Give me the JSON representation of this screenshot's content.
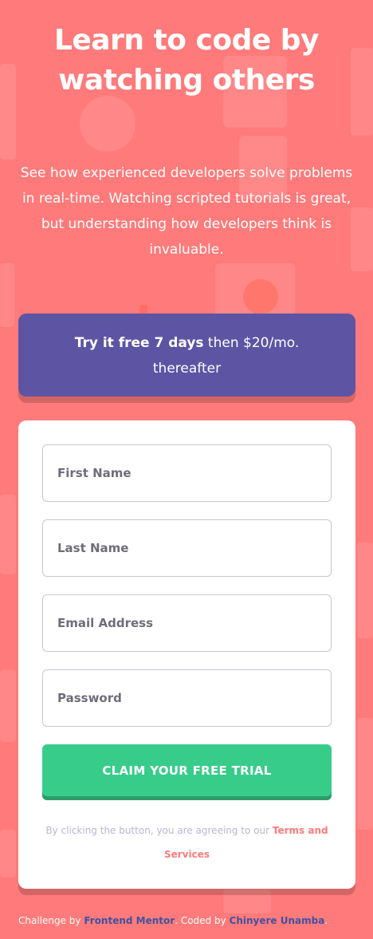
{
  "colors": {
    "background": "#ff7a7a",
    "promo_bg": "#5e54a4",
    "cta_bg": "#38cc8b",
    "terms_link": "#ff7a7a",
    "attribution_link": "#3e52a3"
  },
  "hero": {
    "title_line1": "Learn to code by",
    "title_line2": "watching others",
    "description": "See how experienced developers solve problems in real-time. Watching scripted tutorials is great, but understanding how developers think is invaluable."
  },
  "promo": {
    "bold_text": "Try it free 7 days",
    "rest_text": " then $20/mo. thereafter"
  },
  "form": {
    "first_name_placeholder": "First Name",
    "last_name_placeholder": "Last Name",
    "email_placeholder": "Email Address",
    "password_placeholder": "Password",
    "submit_label": "CLAIM YOUR FREE TRIAL",
    "terms_text": "By clicking the button, you are agreeing to our ",
    "terms_link": "Terms and Services"
  },
  "attribution": {
    "prefix": "Challenge by ",
    "frontend_mentor": "Frontend Mentor",
    "middle": ". Coded by ",
    "author": "Chinyere Unamba",
    "suffix": "."
  }
}
